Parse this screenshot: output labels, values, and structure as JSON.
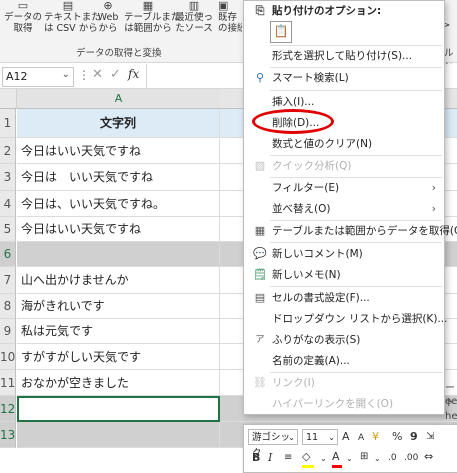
{
  "ribbon": {
    "buttons": [
      {
        "label": "データの\n取得",
        "icon": "get-data-icon"
      },
      {
        "label": "テキストまた\nは CSV から",
        "icon": "text-csv-icon"
      },
      {
        "label": "Web\nから",
        "icon": "web-icon"
      },
      {
        "label": "テーブルまた\nは範囲から",
        "icon": "table-range-icon"
      },
      {
        "label": "最近使っ\nたソース",
        "icon": "recent-sources-icon"
      },
      {
        "label": "既存\nの接続",
        "icon": "existing-connections-icon"
      }
    ],
    "group_label": "データの取得と変換",
    "group_label_right": "ルと変換"
  },
  "formula_bar": {
    "name_box": "A12",
    "fx": "fx"
  },
  "grid": {
    "column_a": "A",
    "rows": [
      {
        "num": "1",
        "text": "文字列"
      },
      {
        "num": "2",
        "text": "今日はいい天気ですね"
      },
      {
        "num": "3",
        "text": "今日は　いい天気ですね"
      },
      {
        "num": "4",
        "text": "今日は、いい天気ですね。"
      },
      {
        "num": "5",
        "text": "今日はいい天気ですね"
      },
      {
        "num": "6",
        "text": ""
      },
      {
        "num": "7",
        "text": "山へ出かけませんか"
      },
      {
        "num": "8",
        "text": "海がきれいです"
      },
      {
        "num": "9",
        "text": "私は元気です"
      },
      {
        "num": "10",
        "text": "すがすがしい天気です"
      },
      {
        "num": "11",
        "text": "おなかが空きました"
      },
      {
        "num": "12",
        "text": ""
      },
      {
        "num": "13",
        "text": ""
      }
    ],
    "right_text_1": "ート",
    "right_text_2": "eet1",
    "right_text_3": "heet1"
  },
  "context_menu": {
    "paste_options_label": "貼り付けのオプション:",
    "items": {
      "paste_special": "形式を選択して貼り付け(S)...",
      "smart_lookup": "スマート検索(L)",
      "insert": "挿入(I)...",
      "delete": "削除(D)...",
      "clear_contents": "数式と値のクリア(N)",
      "quick_analysis": "クイック分析(Q)",
      "filter": "フィルター(E)",
      "sort": "並べ替え(O)",
      "get_data_from_table": "テーブルまたは範囲からデータを取得(G)...",
      "new_comment": "新しいコメント(M)",
      "new_note": "新しいメモ(N)",
      "format_cells": "セルの書式設定(F)...",
      "pick_from_list": "ドロップダウン リストから選択(K)...",
      "show_phonetic": "ふりがなの表示(S)",
      "define_name": "名前の定義(A)...",
      "link": "リンク(I)",
      "open_hyperlink": "ハイパーリンクを開く(O)"
    }
  },
  "mini_toolbar": {
    "font_name": "游ゴシック",
    "font_size": "11",
    "grow": "A",
    "shrink": "A",
    "currency": "¥",
    "percent": "%",
    "comma": "9",
    "bold": "B",
    "italic": "I",
    "font_color": "A"
  },
  "colors": {
    "header_fill": "#ddebf7",
    "selected_row_fill": "#d0d0d0",
    "highlight_circle": "#e00000",
    "font_color_bar": "#ff0000",
    "fill_color_bar": "#ffff00"
  }
}
